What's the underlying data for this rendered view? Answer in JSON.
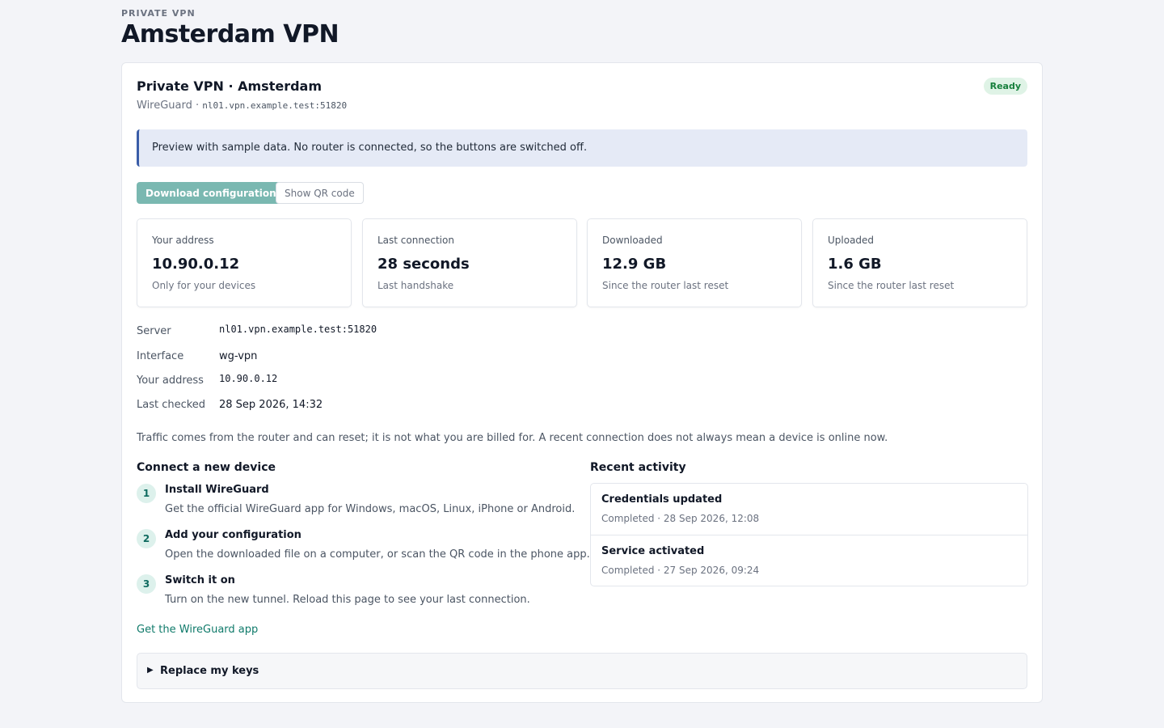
{
  "header": {
    "eyebrow": "PRIVATE VPN",
    "title": "Amsterdam VPN"
  },
  "card": {
    "title": "Private VPN · Amsterdam",
    "protocol": "WireGuard · ",
    "endpoint": "nl01.vpn.example.test:51820",
    "status": "Ready"
  },
  "notice": "Preview with sample data. No router is connected, so the buttons are switched off.",
  "actions": {
    "download_label": "Download configuration",
    "qr_label": "Show QR code"
  },
  "stats": [
    {
      "label": "Your address",
      "value": "10.90.0.12",
      "note": "Only for your devices"
    },
    {
      "label": "Last connection",
      "value": "28 seconds",
      "note": "Last handshake"
    },
    {
      "label": "Downloaded",
      "value": "12.9 GB",
      "note": "Since the router last reset"
    },
    {
      "label": "Uploaded",
      "value": "1.6 GB",
      "note": "Since the router last reset"
    }
  ],
  "details": [
    {
      "key": "Server",
      "value": "nl01.vpn.example.test:51820"
    },
    {
      "key": "Interface",
      "value": "wg-vpn"
    },
    {
      "key": "Your address",
      "value": "10.90.0.12"
    },
    {
      "key": "Last checked",
      "value": "28 Sep 2026, 14:32"
    }
  ],
  "footnote": "Traffic comes from the router and can reset; it is not what you are billed for. A recent connection does not always mean a device is online now.",
  "connect": {
    "heading": "Connect a new device",
    "steps": [
      {
        "num": "1",
        "title": "Install WireGuard",
        "text": "Get the official WireGuard app for Windows, macOS, Linux, iPhone or Android."
      },
      {
        "num": "2",
        "title": "Add your configuration",
        "text": "Open the downloaded file on a computer, or scan the QR code in the phone app."
      },
      {
        "num": "3",
        "title": "Switch it on",
        "text": "Turn on the new tunnel. Reload this page to see your last connection."
      }
    ],
    "app_link": "Get the WireGuard app"
  },
  "activity": {
    "heading": "Recent activity",
    "items": [
      {
        "title": "Credentials updated",
        "meta": "Completed · 28 Sep 2026, 12:08"
      },
      {
        "title": "Service activated",
        "meta": "Completed · 27 Sep 2026, 09:24"
      }
    ]
  },
  "replace_keys": {
    "caret": "▶",
    "label": "Replace my keys"
  }
}
